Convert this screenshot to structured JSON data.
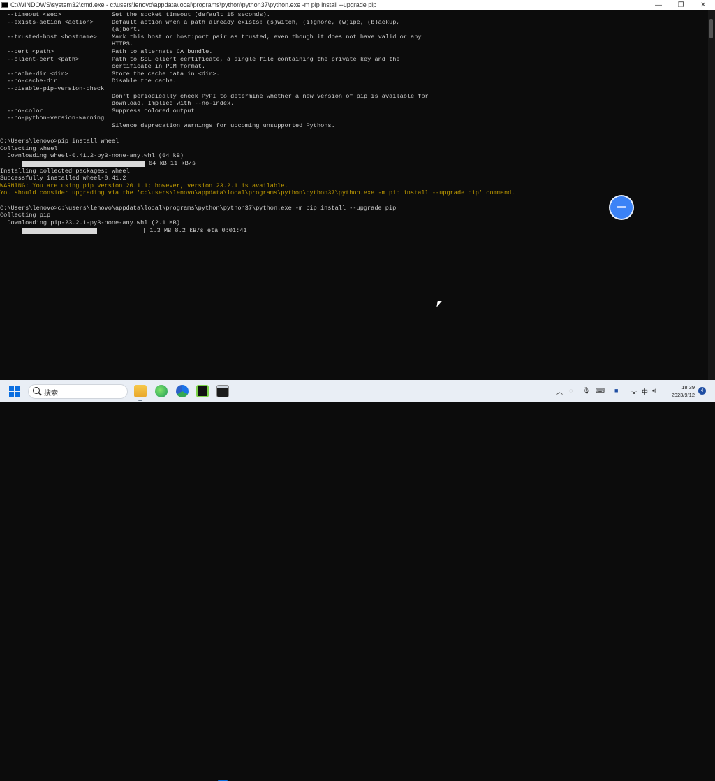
{
  "window": {
    "title": "C:\\WINDOWS\\system32\\cmd.exe - c:\\users\\lenovo\\appdata\\local\\programs\\python\\python37\\python.exe  -m pip install --upgrade pip",
    "minimize": "—",
    "maximize": "❐",
    "close": "✕"
  },
  "help_options": [
    {
      "opt": "--timeout <sec>",
      "desc": "Set the socket timeout (default 15 seconds)."
    },
    {
      "opt": "--exists-action <action>",
      "desc": "Default action when a path already exists: (s)witch, (i)gnore, (w)ipe, (b)ackup,"
    },
    {
      "opt": "",
      "desc": "(a)bort."
    },
    {
      "opt": "--trusted-host <hostname>",
      "desc": "Mark this host or host:port pair as trusted, even though it does not have valid or any"
    },
    {
      "opt": "",
      "desc": "HTTPS."
    },
    {
      "opt": "--cert <path>",
      "desc": "Path to alternate CA bundle."
    },
    {
      "opt": "--client-cert <path>",
      "desc": "Path to SSL client certificate, a single file containing the private key and the"
    },
    {
      "opt": "",
      "desc": "certificate in PEM format."
    },
    {
      "opt": "--cache-dir <dir>",
      "desc": "Store the cache data in <dir>."
    },
    {
      "opt": "--no-cache-dir",
      "desc": "Disable the cache."
    },
    {
      "opt": "--disable-pip-version-check",
      "desc": ""
    },
    {
      "opt": "",
      "desc": "Don't periodically check PyPI to determine whether a new version of pip is available for"
    },
    {
      "opt": "",
      "desc": "download. Implied with --no-index."
    },
    {
      "opt": "--no-color",
      "desc": "Suppress colored output"
    },
    {
      "opt": "--no-python-version-warning",
      "desc": ""
    },
    {
      "opt": "",
      "desc": "Silence deprecation warnings for upcoming unsupported Pythons."
    }
  ],
  "session": {
    "prompt1": "C:\\Users\\lenovo>pip install wheel",
    "collecting_wheel": "Collecting wheel",
    "downloading_wheel": "  Downloading wheel-0.41.2-py3-none-any.whl (64 kB)",
    "wheel_progress_text": "64 kB 11 kB/s",
    "wheel_progress": 1.0,
    "installing": "Installing collected packages: wheel",
    "success": "Successfully installed wheel-0.41.2",
    "warning": "WARNING: You are using pip version 20.1.1; however, version 23.2.1 is available.",
    "advice": "You should consider upgrading via the 'c:\\users\\lenovo\\appdata\\local\\programs\\python\\python37\\python.exe -m pip install --upgrade pip' command.",
    "prompt2": "C:\\Users\\lenovo>c:\\users\\lenovo\\appdata\\local\\programs\\python\\python37\\python.exe -m pip install --upgrade pip",
    "collecting_pip": "Collecting pip",
    "downloading_pip": "  Downloading pip-23.2.1-py3-none-any.whl (2.1 MB)",
    "pip_progress_text": "| 1.3 MB 8.2 kB/s eta 0:01:41",
    "pip_progress": 0.62
  },
  "taskbar": {
    "search_placeholder": "搜索",
    "apps": [
      "file-explorer-icon",
      "edge-icon",
      "chrome-icon",
      "pycharm-icon",
      "cmd-icon"
    ],
    "tray": {
      "chevron": "︿",
      "time": "18:39",
      "date": "2023/9/12",
      "notification_count": "4"
    }
  }
}
